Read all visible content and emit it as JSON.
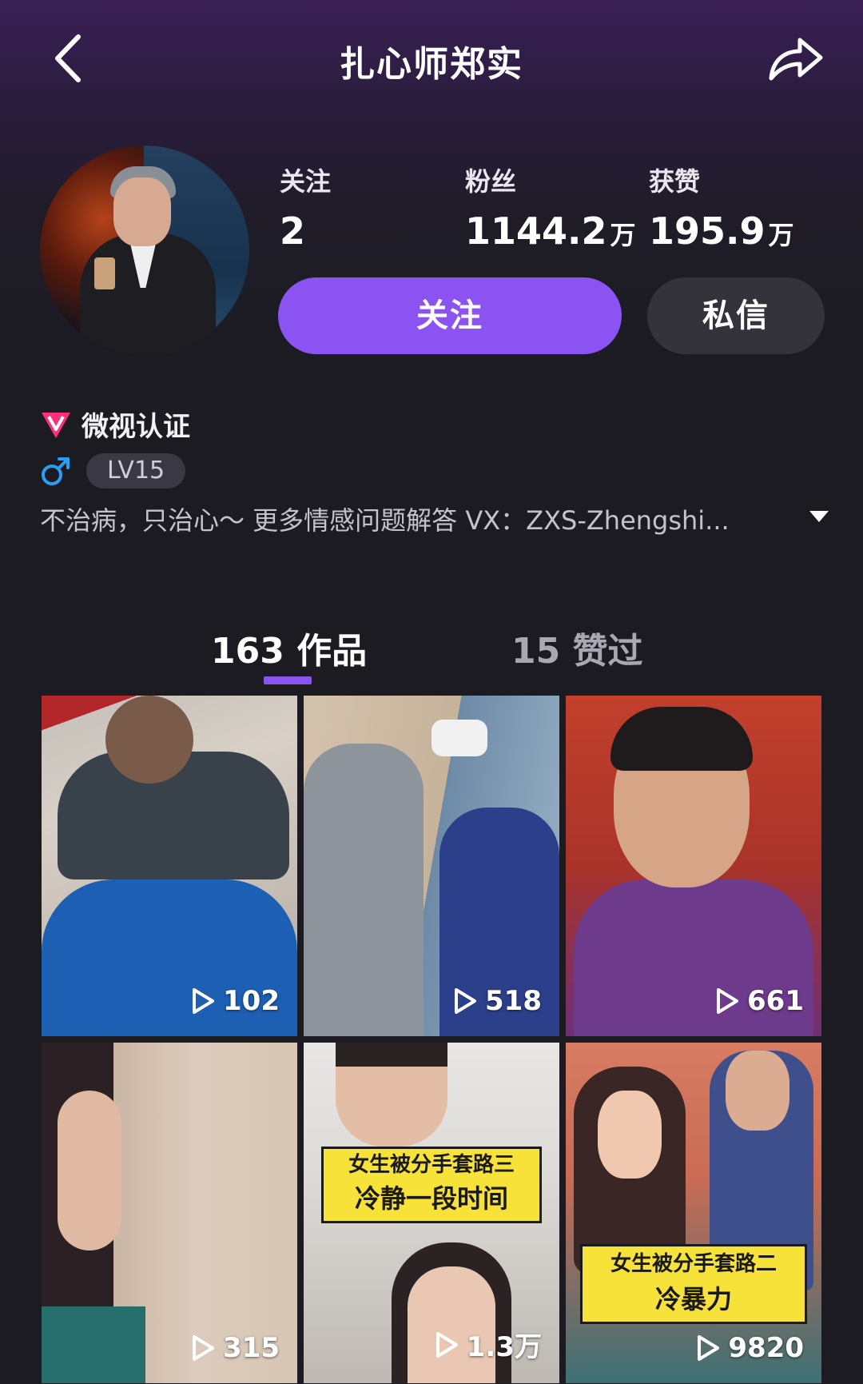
{
  "header": {
    "title": "扎心师郑实"
  },
  "profile": {
    "stats": [
      {
        "label": "关注",
        "value": "2",
        "unit": ""
      },
      {
        "label": "粉丝",
        "value": "1144.2",
        "unit": "万"
      },
      {
        "label": "获赞",
        "value": "195.9",
        "unit": "万"
      }
    ],
    "follow_label": "关注",
    "message_label": "私信",
    "verification": "微视认证",
    "level": "LV15",
    "bio": "不治病，只治心～ 更多情感问题解答 VX：ZXS-Zhengshi..."
  },
  "tabs": [
    {
      "count": "163",
      "label": "作品"
    },
    {
      "count": "15",
      "label": "赞过"
    }
  ],
  "videos": [
    {
      "views": "102"
    },
    {
      "views": "518"
    },
    {
      "views": "661"
    },
    {
      "views": "315"
    },
    {
      "views": "1.3万",
      "caption_line1": "女生被分手套路三",
      "caption_line2": "冷静一段时间"
    },
    {
      "views": "9820",
      "caption_line1": "女生被分手套路二",
      "caption_line2": "冷暴力"
    }
  ],
  "colors": {
    "accent": "#8b53f2",
    "background": "#1c1b22",
    "verify_icon": "#ff2d7a",
    "gender_icon": "#2a9df4"
  },
  "icons": {
    "back": "chevron-left-icon",
    "share": "share-arrow-icon",
    "play": "play-icon",
    "verify": "v-badge-icon",
    "gender": "male-icon",
    "expand": "caret-down-icon"
  }
}
